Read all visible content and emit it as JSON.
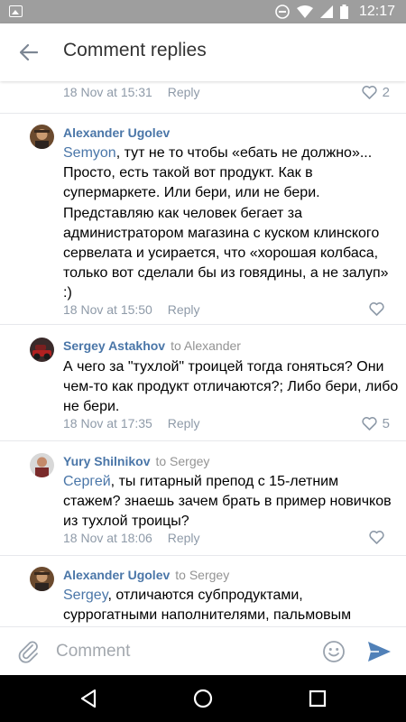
{
  "status_bar": {
    "time": "12:17",
    "icons": [
      "image-icon",
      "dnd-icon",
      "wifi-icon",
      "signal-icon",
      "battery-icon"
    ]
  },
  "header": {
    "title": "Comment replies",
    "back_icon": "arrow-left-icon"
  },
  "first_comment_meta": {
    "date": "18 Nov at 15:31",
    "reply": "Reply",
    "likes": "2"
  },
  "comments": [
    {
      "author": "Alexander Ugolev",
      "to": "",
      "mention": "Semyon",
      "text": ", тут не то чтобы «ебать не должно»... Просто, есть такой вот продукт. Как в супермаркете. Или бери, или не бери. Представляю как человек бегает за администратором магазина с куском клинского сервелата и усирается, что «хорошая колбаса, только вот сделали бы из говядины, а не залуп» :)",
      "date": "18 Nov at 15:50",
      "reply": "Reply",
      "likes": ""
    },
    {
      "author": "Sergey Astakhov",
      "to": "to Alexander",
      "mention": "",
      "text": "А чего за \"тухлой\" троицей тогда гоняться? Они чем-то как продукт отличаются?; Либо бери, либо не бери.",
      "date": "18 Nov at 17:35",
      "reply": "Reply",
      "likes": "5"
    },
    {
      "author": "Yury Shilnikov",
      "to": "to Sergey",
      "mention": "Сергей",
      "text": ", ты гитарный препод с 15-летним стажем? знаешь зачем брать в пример новичков из тухлой троицы?",
      "date": "18 Nov at 18:06",
      "reply": "Reply",
      "likes": ""
    },
    {
      "author": "Alexander Ugolev",
      "to": "to Sergey",
      "mention": "Sergey",
      "text": ", отличаются субпродуктами, суррогатными наполнителями, пальмовым",
      "date": "",
      "reply": "",
      "likes": ""
    }
  ],
  "composer": {
    "placeholder": "Comment",
    "icons": [
      "paperclip-icon",
      "emoji-icon",
      "send-icon"
    ]
  },
  "nav_bar": {
    "icons": [
      "back-triangle-icon",
      "home-circle-icon",
      "recents-square-icon"
    ]
  },
  "colors": {
    "accent": "#4a76a8",
    "meta": "#8e9aa8",
    "status_bar": "#9e9e9e",
    "send": "#5181b8"
  }
}
